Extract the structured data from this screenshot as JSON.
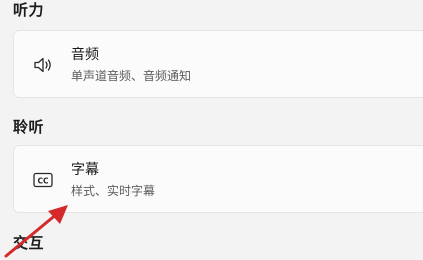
{
  "sections": {
    "hearing": "听力",
    "listen": "聆听",
    "interaction": "交互"
  },
  "cards": {
    "audio": {
      "title": "音频",
      "subtitle": "单声道音频、音频通知",
      "icon": "speaker-icon"
    },
    "captions": {
      "title": "字幕",
      "subtitle": "样式、实时字幕",
      "icon": "closed-captions-icon"
    }
  },
  "annotation": {
    "arrow_color": "#d42a2a"
  }
}
